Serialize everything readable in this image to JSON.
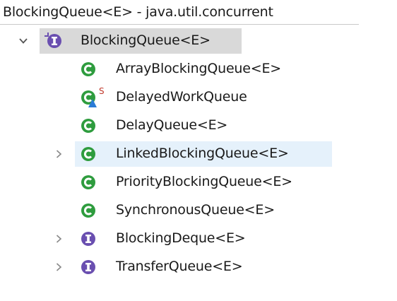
{
  "header": {
    "title": "BlockingQueue<E> - java.util.concurrent"
  },
  "colors": {
    "class_icon": "#2e9c3e",
    "interface_icon": "#6a4fb0",
    "selection": "#d9d9d9",
    "hover": "#e5f1fb",
    "static_marker": "#c0392b",
    "warning_marker": "#2a7bd6"
  },
  "tree": {
    "root": {
      "label": "BlockingQueue<E>",
      "icon": "interface-icon",
      "expanded": true
    },
    "children": [
      {
        "label": "ArrayBlockingQueue<E>",
        "icon": "class-icon",
        "expandable": false
      },
      {
        "label": "DelayedWorkQueue",
        "icon": "class-icon",
        "expandable": false,
        "static_marker": "S"
      },
      {
        "label": "DelayQueue<E>",
        "icon": "class-icon",
        "expandable": false
      },
      {
        "label": "LinkedBlockingQueue<E>",
        "icon": "class-icon",
        "expandable": true
      },
      {
        "label": "PriorityBlockingQueue<E>",
        "icon": "class-icon",
        "expandable": false
      },
      {
        "label": "SynchronousQueue<E>",
        "icon": "class-icon",
        "expandable": false
      },
      {
        "label": "BlockingDeque<E>",
        "icon": "interface-icon",
        "expandable": true
      },
      {
        "label": "TransferQueue<E>",
        "icon": "interface-icon",
        "expandable": true
      }
    ]
  }
}
